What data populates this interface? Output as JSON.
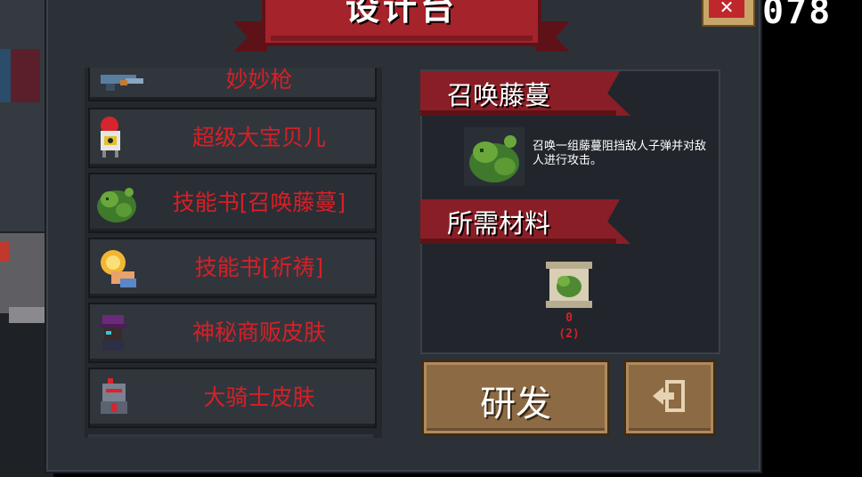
{
  "title": "设计台",
  "coins": "078",
  "list": {
    "items": [
      {
        "label": "妙妙枪",
        "icon": "gun-icon"
      },
      {
        "label": "超级大宝贝儿",
        "icon": "robot-baby-icon"
      },
      {
        "label": "技能书[召唤藤蔓]",
        "icon": "vine-icon"
      },
      {
        "label": "技能书[祈祷]",
        "icon": "prayer-hand-icon"
      },
      {
        "label": "神秘商贩皮肤",
        "icon": "merchant-icon"
      },
      {
        "label": "大骑士皮肤",
        "icon": "knight-icon"
      }
    ]
  },
  "detail": {
    "name": "召唤藤蔓",
    "description": "召唤一组藤蔓阻挡敌人子弹并对敌人进行攻击。",
    "materials_title": "所需材料",
    "material": {
      "icon": "scroll-vine-icon",
      "owned": "0",
      "required": "(2)"
    }
  },
  "buttons": {
    "research": "研发",
    "exit_icon": "exit-icon"
  },
  "colors": {
    "accent_red": "#d81f26",
    "ribbon_red": "#8a1e26",
    "button_brown": "#8b6a44"
  }
}
